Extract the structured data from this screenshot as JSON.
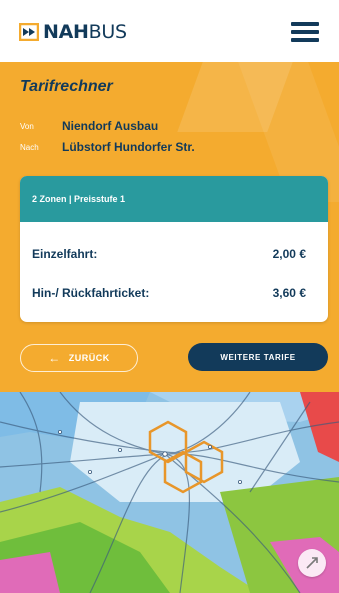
{
  "header": {
    "logo_bold": "NAH",
    "logo_light": "BUS",
    "menu_icon": "hamburger-menu-icon"
  },
  "calculator": {
    "title": "Tarifrechner",
    "from_label": "Von",
    "from_value": "Niendorf Ausbau",
    "to_label": "Nach",
    "to_value": "Lübstorf Hundorfer Str.",
    "zone_info": "2 Zonen | Preisstufe 1",
    "prices": [
      {
        "label": "Einzelfahrt:",
        "price": "2,00 €"
      },
      {
        "label": "Hin-/ Rückfahrticket:",
        "price": "3,60 €"
      }
    ],
    "back_label": "ZURÜCK",
    "more_label": "WEITERE TARIFE"
  },
  "colors": {
    "panel": "#f4ab2f",
    "navy": "#123a5a",
    "teal": "#299a9e"
  },
  "map": {
    "zoom_icon": "expand-map-icon"
  }
}
